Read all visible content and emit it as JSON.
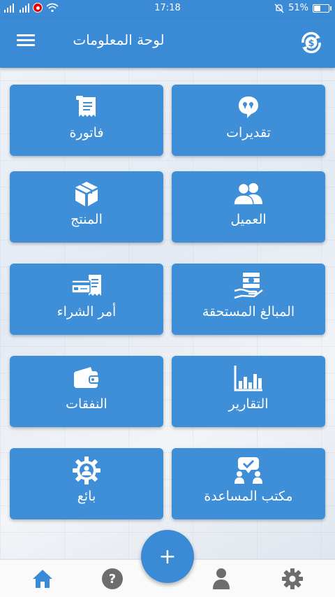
{
  "status": {
    "time": "17:18",
    "battery": "51%",
    "icons": [
      "signal-icon",
      "signal-icon",
      "vodafone-icon",
      "wifi-icon",
      "mute-icon",
      "battery-icon"
    ]
  },
  "header": {
    "title": "لوحة المعلومات",
    "menu_icon": "menu-icon",
    "sync_icon": "sync-dollar-icon"
  },
  "tiles": [
    {
      "label": "تقديرات",
      "icon": "quote-bubble-icon"
    },
    {
      "label": "فاتورة",
      "icon": "receipt-icon"
    },
    {
      "label": "العميل",
      "icon": "customers-icon"
    },
    {
      "label": "المنتج",
      "icon": "box-icon"
    },
    {
      "label": "المبالغ المستحقة",
      "icon": "money-hand-icon"
    },
    {
      "label": "أمر الشراء",
      "icon": "purchase-order-icon"
    },
    {
      "label": "التقارير",
      "icon": "bar-chart-icon"
    },
    {
      "label": "النفقات",
      "icon": "wallet-icon"
    },
    {
      "label": "مكتب المساعدة",
      "icon": "helpdesk-icon"
    },
    {
      "label": "بائع",
      "icon": "vendor-gear-icon"
    }
  ],
  "fab": {
    "label": "+"
  },
  "bottom_nav": [
    {
      "icon": "home-icon",
      "active": true
    },
    {
      "icon": "help-icon",
      "active": false
    },
    {
      "icon": "user-icon",
      "active": false
    },
    {
      "icon": "settings-icon",
      "active": false
    }
  ],
  "colors": {
    "primary": "#3a8ad6",
    "tile": "#3e8ed8",
    "nav_active": "#3a8ad6",
    "nav_inactive": "#6d6d6d"
  }
}
